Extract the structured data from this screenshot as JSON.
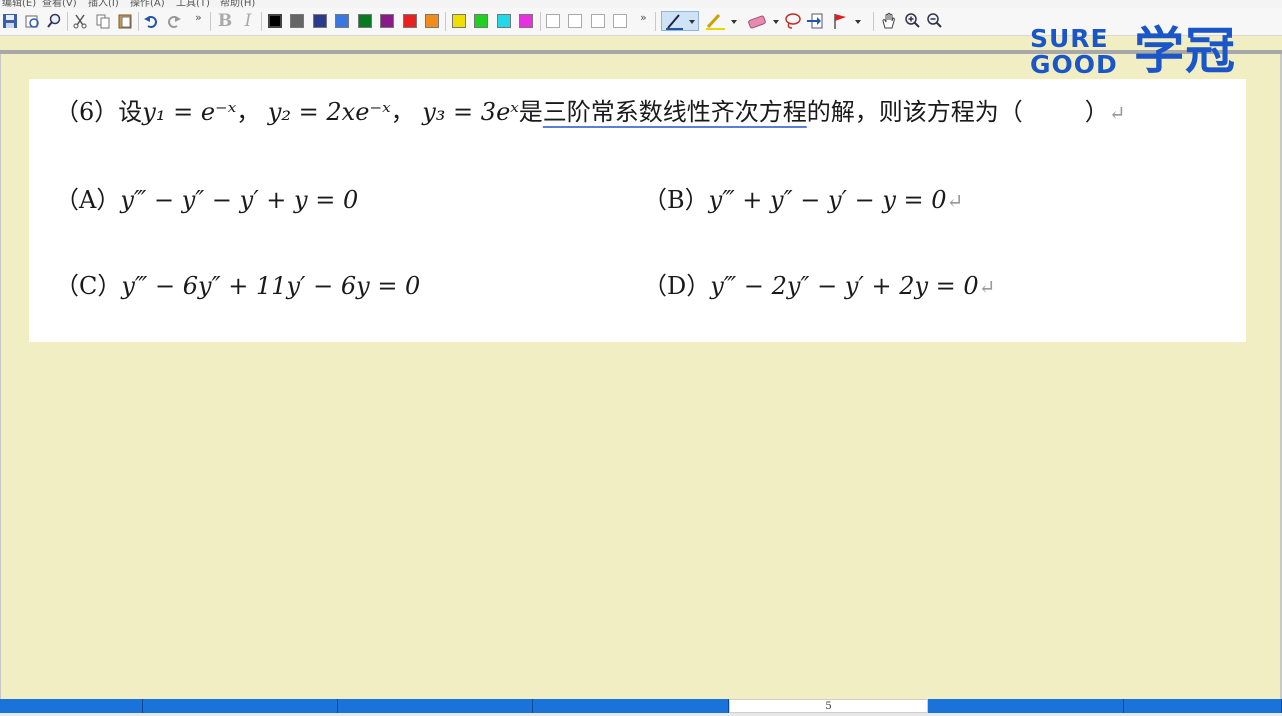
{
  "menubar": {
    "items": [
      "编辑(E)",
      "查看(V)",
      "插入(I)",
      "操作(A)",
      "工具(T)",
      "帮助(H)"
    ]
  },
  "toolbar": {
    "more_glyph": "»",
    "colors": [
      "#000000",
      "#666666",
      "#2c3a8a",
      "#3a78e0",
      "#0a7a20",
      "#8a1a8a",
      "#e82020",
      "#f08c1a",
      "#f0e000",
      "#20d020",
      "#20d8e8",
      "#e830e0"
    ]
  },
  "logo": {
    "en_line1": "SURE",
    "en_line2": "GOOD",
    "cn": "学冠"
  },
  "question": {
    "stem_prefix": "（6）设",
    "stem_middle": "是",
    "underlined_term": "三阶常系数线性齐次方程",
    "stem_suffix": "的解，则该方程为（",
    "blank_close": "）",
    "eq1": "y₁ = e⁻ˣ",
    "eq2": "y₂ = 2xe⁻ˣ",
    "eq3": "y₃ = 3eˣ",
    "return_mark": "↵",
    "options": [
      {
        "label": "（A）",
        "formula": "y‴ − y″ − y′ + y = 0"
      },
      {
        "label": "（B）",
        "formula": "y‴ + y″ − y′ − y = 0"
      },
      {
        "label": "（C）",
        "formula": "y‴ − 6y″ + 11y′ − 6y = 0"
      },
      {
        "label": "（D）",
        "formula": "y‴ − 2y″ − y′ + 2y = 0"
      }
    ]
  },
  "statusbar": {
    "page": "5"
  }
}
